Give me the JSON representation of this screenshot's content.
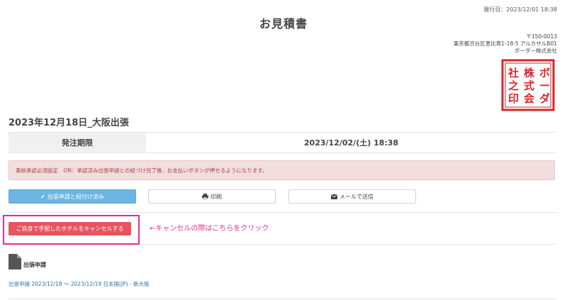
{
  "header": {
    "issued": "発行日：2023/12/01 18:38",
    "title": "お見積書"
  },
  "company": {
    "postal": "〒150-0013",
    "address": "東京都渋谷区恵比寿1-18-5 アルカサルB01",
    "name": "ボーダー株式会社"
  },
  "seal": {
    "text": "ボーダー株式会社之印",
    "color": "#d6262b"
  },
  "trip": {
    "title": "2023年12月18日_大阪出張"
  },
  "deadline": {
    "label": "発注期限",
    "value": "2023/12/02/(土) 18:38"
  },
  "alert": {
    "text": "事前承認必須設定　ON：承認済み出張申請との紐づけ完了後、お支払いボタンが押せるようになります。"
  },
  "buttons": {
    "linked": "出張申請と紐付け済み",
    "print": "印刷",
    "mail": "メールで送信",
    "cancel": "ご自身で手配したホテルをキャンセルする"
  },
  "annotation": {
    "text": "←キャンセルの際はこちらをクリック",
    "color": "#e0308a"
  },
  "section": {
    "title": "出張申請",
    "link": "出張申請 2023/12/18 ～ 2023/12/19 日本国(JP) - 新大阪"
  },
  "colors": {
    "primary_button": "#6cb4e3",
    "danger_button": "#e8535e",
    "alert_bg": "#f2dede",
    "link": "#2a6fb3"
  }
}
